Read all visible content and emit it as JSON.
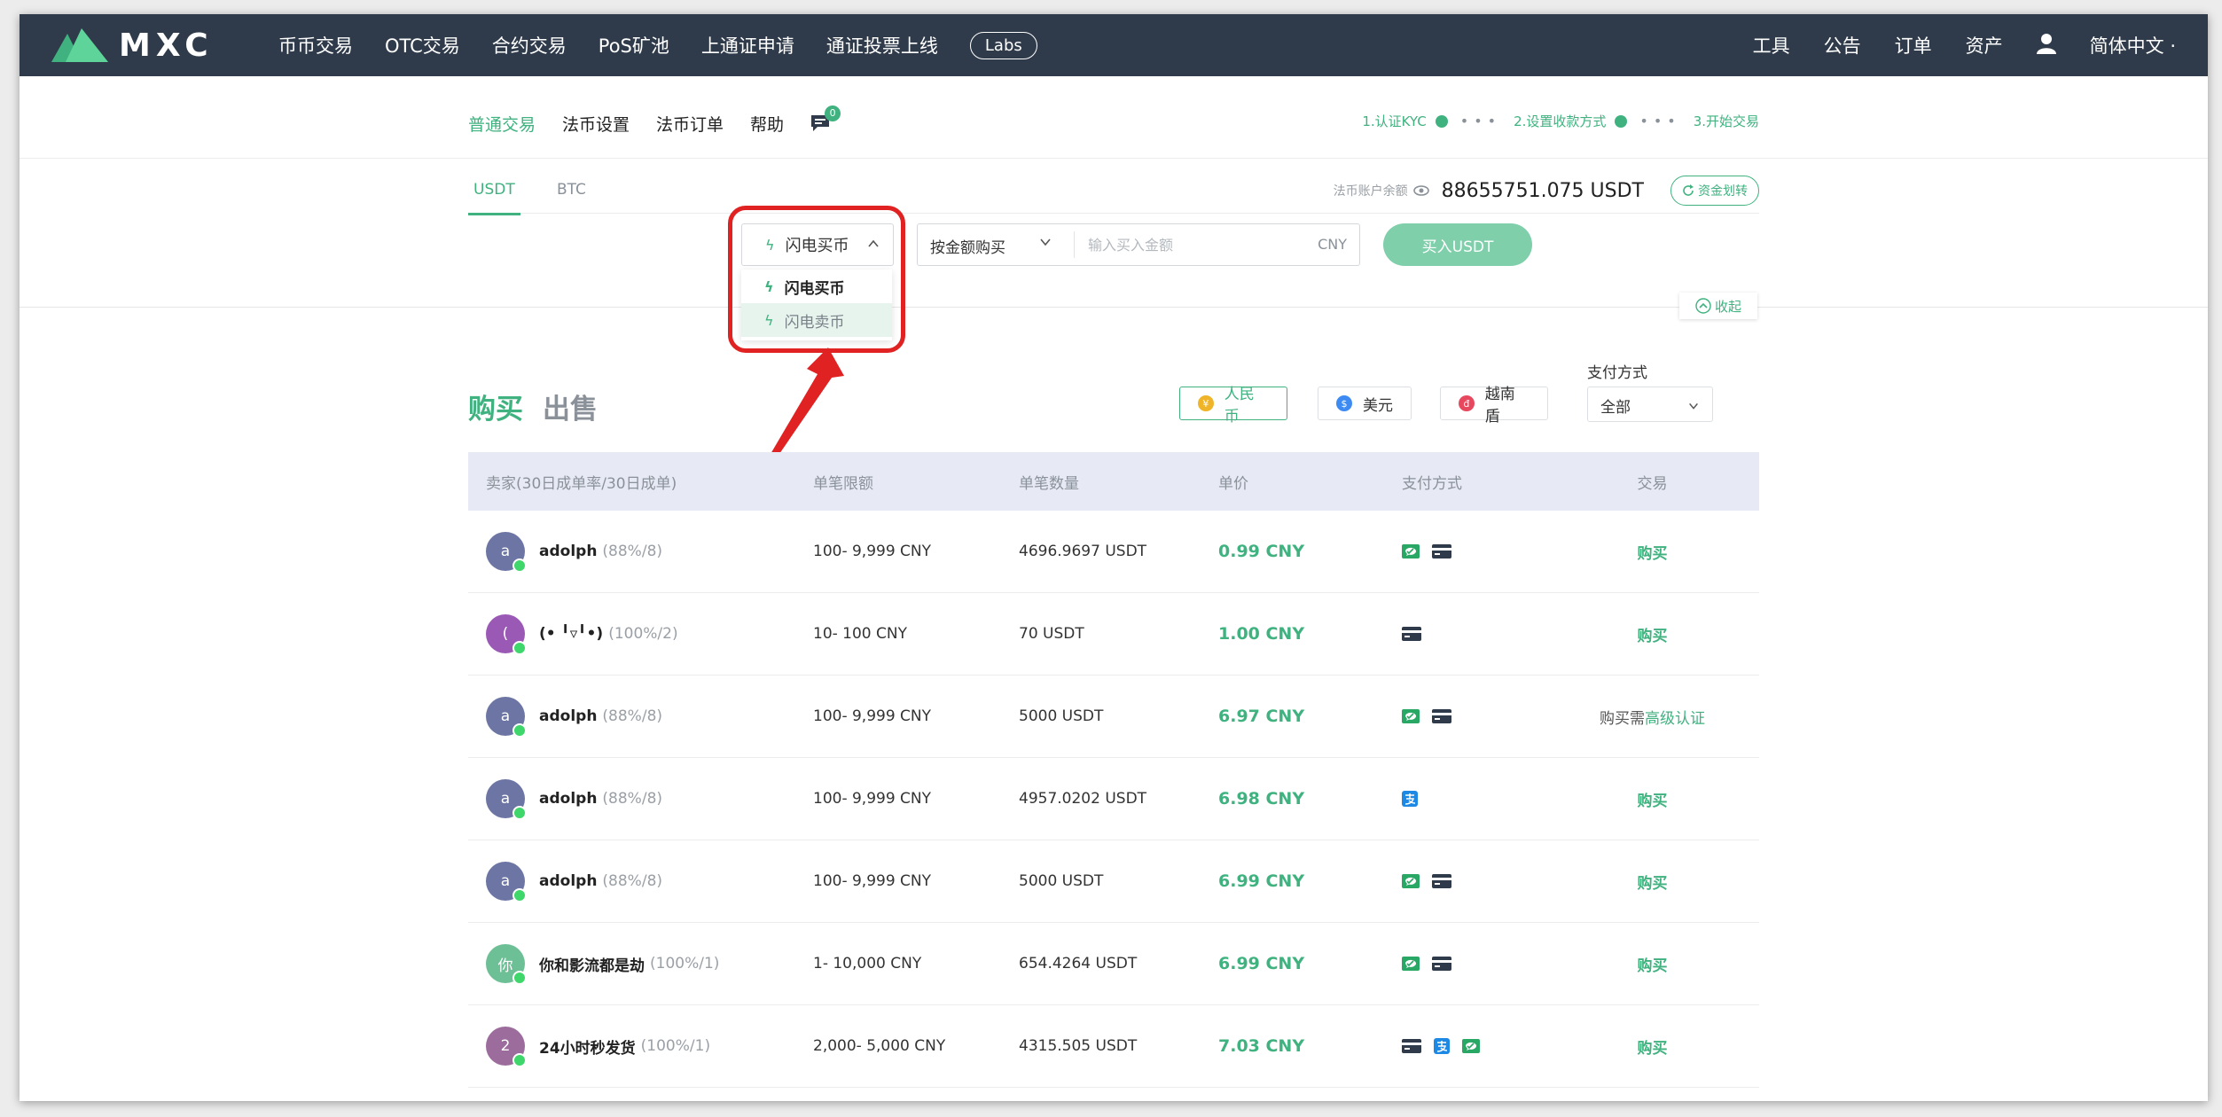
{
  "nav": {
    "logo_text": "MXC",
    "items": [
      "币币交易",
      "OTC交易",
      "合约交易",
      "PoS矿池",
      "上通证申请",
      "通证投票上线"
    ],
    "labs": "Labs",
    "right": {
      "tools": "工具",
      "notice": "公告",
      "orders": "订单",
      "assets": "资产",
      "language": "简体中文 ·"
    }
  },
  "subnav": {
    "items": [
      "普通交易",
      "法币设置",
      "法币订单",
      "帮助"
    ],
    "message_count": "0",
    "steps": [
      "1.认证KYC",
      "2.设置收款方式",
      "3.开始交易"
    ]
  },
  "coin_tabs": [
    "USDT",
    "BTC"
  ],
  "balance": {
    "label": "法币账户余额",
    "value": "88655751.075 USDT",
    "transfer": "资金划转"
  },
  "buy_form": {
    "mode": "闪电买币",
    "amount_type": "按金额购买",
    "amount_placeholder": "输入买入金额",
    "unit": "CNY",
    "submit": "买入USDT"
  },
  "dropdown": {
    "options": [
      "闪电买币",
      "闪电卖币"
    ]
  },
  "collapse": "收起",
  "trade_tabs": {
    "buy": "购买",
    "sell": "出售"
  },
  "currencies": [
    {
      "label": "人民币",
      "symbol": "¥",
      "color": "#f0b429"
    },
    {
      "label": "美元",
      "symbol": "$",
      "color": "#3d8bf2"
    },
    {
      "label": "越南盾",
      "symbol": "đ",
      "color": "#e8485e"
    }
  ],
  "payment_filter": {
    "label": "支付方式",
    "value": "全部"
  },
  "table": {
    "headers": [
      "卖家(30日成单率/30日成单)",
      "单笔限额",
      "单笔数量",
      "单价",
      "支付方式",
      "交易"
    ],
    "rows": [
      {
        "avatar": "a",
        "avatar_color": "#6c75a3",
        "name": "adolph",
        "stats": "(88%/8)",
        "limit": "100- 9,999 CNY",
        "qty": "4696.9697 USDT",
        "price": "0.99 CNY",
        "pay": [
          "wechat-icon",
          "bank-card-icon"
        ],
        "action": "购买"
      },
      {
        "avatar": "(",
        "avatar_color": "#9b59b6",
        "name": "(• ╹▿╹•)",
        "stats": "(100%/2)",
        "limit": "10- 100 CNY",
        "qty": "70 USDT",
        "price": "1.00 CNY",
        "pay": [
          "bank-card-icon"
        ],
        "action": "购买"
      },
      {
        "avatar": "a",
        "avatar_color": "#6c75a3",
        "name": "adolph",
        "stats": "(88%/8)",
        "limit": "100- 9,999 CNY",
        "qty": "5000 USDT",
        "price": "6.97 CNY",
        "pay": [
          "wechat-icon",
          "bank-card-icon"
        ],
        "action": "",
        "action_note": "购买需",
        "action_link": "高级认证"
      },
      {
        "avatar": "a",
        "avatar_color": "#6c75a3",
        "name": "adolph",
        "stats": "(88%/8)",
        "limit": "100- 9,999 CNY",
        "qty": "4957.0202 USDT",
        "price": "6.98 CNY",
        "pay": [
          "alipay-icon"
        ],
        "action": "购买"
      },
      {
        "avatar": "a",
        "avatar_color": "#6c75a3",
        "name": "adolph",
        "stats": "(88%/8)",
        "limit": "100- 9,999 CNY",
        "qty": "5000 USDT",
        "price": "6.99 CNY",
        "pay": [
          "wechat-icon",
          "bank-card-icon"
        ],
        "action": "购买"
      },
      {
        "avatar": "你",
        "avatar_color": "#6dbf95",
        "name": "你和影流都是劫",
        "stats": "(100%/1)",
        "limit": "1- 10,000 CNY",
        "qty": "654.4264 USDT",
        "price": "6.99 CNY",
        "pay": [
          "wechat-icon",
          "bank-card-icon"
        ],
        "action": "购买"
      },
      {
        "avatar": "2",
        "avatar_color": "#9c6c9c",
        "name": "24小时秒发货",
        "stats": "(100%/1)",
        "limit": "2,000- 5,000 CNY",
        "qty": "4315.505 USDT",
        "price": "7.03 CNY",
        "pay": [
          "bank-card-icon",
          "alipay-icon",
          "wechat-icon"
        ],
        "action": "购买"
      }
    ]
  }
}
